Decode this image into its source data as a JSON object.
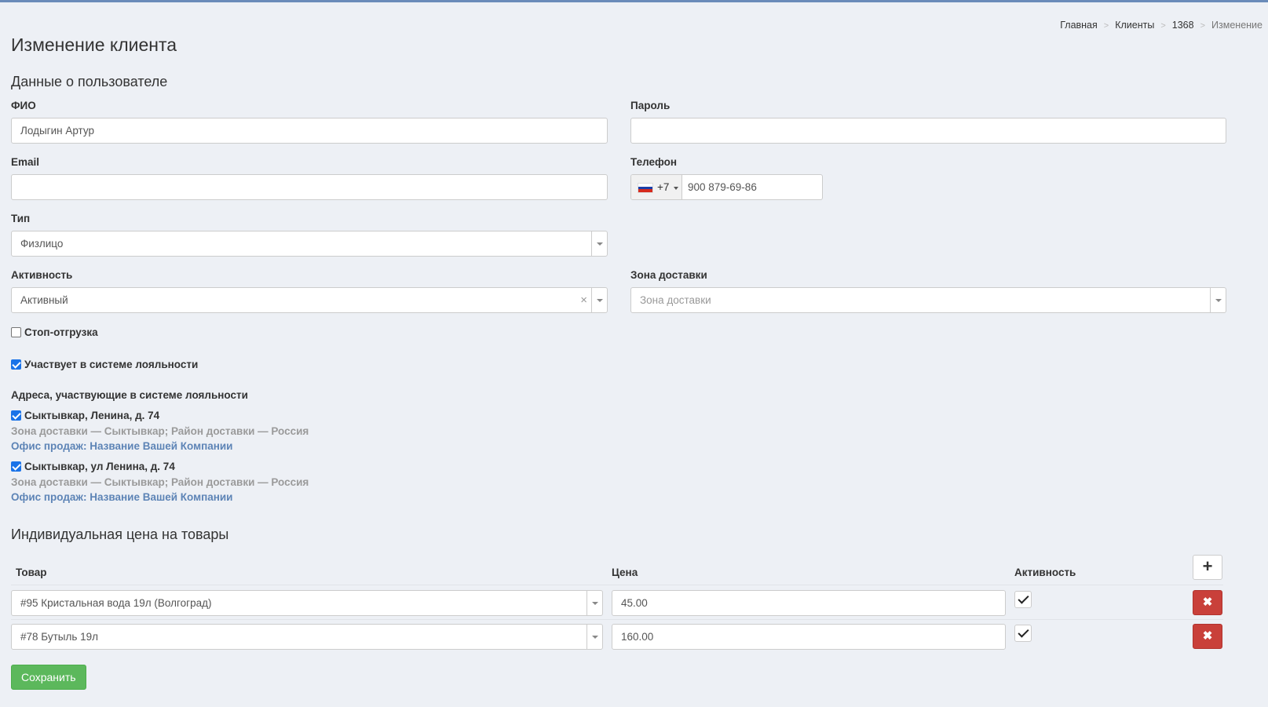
{
  "breadcrumb": [
    "Главная",
    "Клиенты",
    "1368",
    "Изменение"
  ],
  "page_title": "Изменение клиента",
  "user_section_title": "Данные о пользователе",
  "fields": {
    "fio": {
      "label": "ФИО",
      "value": "Лодыгин Артур"
    },
    "password": {
      "label": "Пароль",
      "value": ""
    },
    "email": {
      "label": "Email",
      "value": ""
    },
    "phone": {
      "label": "Телефон",
      "dial_code": "+7",
      "value": "900 879-69-86",
      "flag": "russia-flag"
    },
    "type": {
      "label": "Тип",
      "value": "Физлицо"
    },
    "activity": {
      "label": "Активность",
      "value": "Активный",
      "clear": "×"
    },
    "zone": {
      "label": "Зона доставки",
      "placeholder": "Зона доставки"
    }
  },
  "checkboxes": {
    "stop_shipment": {
      "label": "Стоп-отгрузка",
      "checked": false
    },
    "loyalty": {
      "label": "Участвует в системе лояльности",
      "checked": true
    }
  },
  "addresses_title": "Адреса, участвующие в системе лояльности",
  "addresses": [
    {
      "title": "Сыктывкар, Ленина, д. 74",
      "meta": "Зона доставки — Сыктывкар; Район доставки — Россия",
      "office": "Офис продаж: Название Вашей Компании",
      "checked": true
    },
    {
      "title": "Сыктывкар, ул Ленина, д. 74",
      "meta": "Зона доставки — Сыктывкар; Район доставки — Россия",
      "office": "Офис продаж: Название Вашей Компании",
      "checked": true
    }
  ],
  "prices_section_title": "Индивидуальная цена на товары",
  "prices_table": {
    "headers": {
      "product": "Товар",
      "price": "Цена",
      "active": "Активность"
    },
    "add_icon": "+",
    "delete_icon": "✖",
    "rows": [
      {
        "product": "#95 Кристальная вода 19л (Волгоград)",
        "price": "45.00",
        "active": true
      },
      {
        "product": "#78 Бутыль 19л",
        "price": "160.00",
        "active": true
      }
    ]
  },
  "save_label": "Сохранить",
  "colors": {
    "accent": "#6a8bb9",
    "link": "#5d84b6",
    "danger": "#c9403a",
    "success": "#5cb85c"
  }
}
